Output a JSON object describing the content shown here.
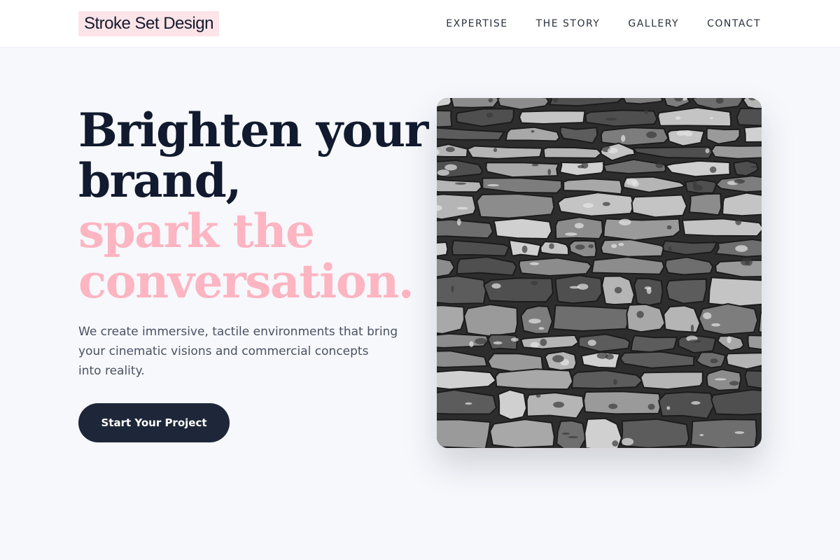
{
  "header": {
    "logo": "Stroke Set Design",
    "nav": [
      "EXPERTISE",
      "THE STORY",
      "GALLERY",
      "CONTACT"
    ]
  },
  "hero": {
    "title_line1": "Brighten your",
    "title_line2": "brand,",
    "accent_line1": "spark the",
    "accent_line2": "conversation.",
    "subtitle_line1": "We create immersive, tactile environments that bring",
    "subtitle_line2": "your cinematic visions and commercial concepts",
    "subtitle_line3": "into reality.",
    "cta_label": "Start Your Project"
  },
  "colors": {
    "background": "#f7f8fc",
    "navy": "#111a2e",
    "accent_pink": "#fdb5c2",
    "logo_highlight": "#fde4e9",
    "button": "#1e2639"
  },
  "image": {
    "subject": "stone-wall-photo"
  }
}
